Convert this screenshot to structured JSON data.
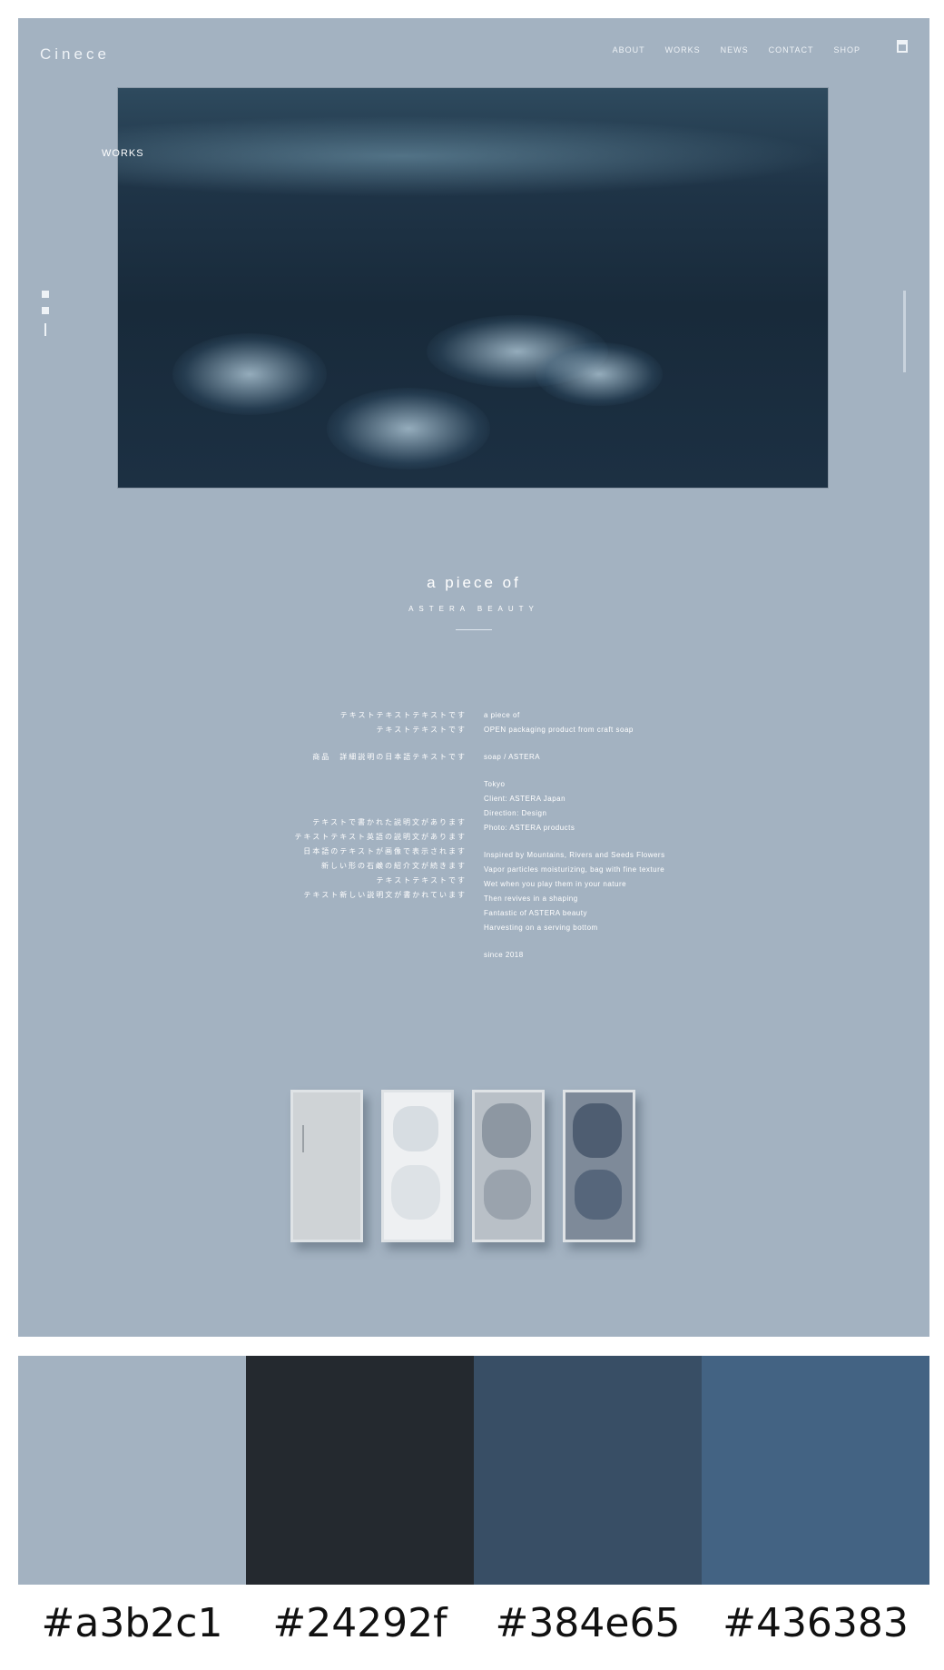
{
  "site": {
    "logo": "Cinece",
    "nav": [
      "ABOUT",
      "WORKS",
      "NEWS",
      "CONTACT",
      "SHOP"
    ],
    "hero_label": "WORKS"
  },
  "product": {
    "title": "a piece of",
    "subtitle": "ASTERA BEAUTY",
    "description_left": [
      "テキストテキストテキストです",
      "テキストテキストです",
      "",
      "商品　詳細説明の日本語テキストです",
      "",
      "テキストで書かれた説明文があります",
      "テキストテキスト英語の説明文があります",
      "日本語のテキストが画像で表示されます",
      "新しい形の石鹸の紹介文が続きます",
      "テキストテキストです",
      "テキスト新しい説明文が書かれています"
    ],
    "description_right": [
      "a piece of",
      "OPEN packaging product from craft soap",
      "",
      "soap / ASTERA",
      "",
      "Tokyo",
      "Client: ASTERA Japan",
      "Direction: Design",
      "Photo: ASTERA products",
      "",
      "Inspired by Mountains, Rivers and Seeds Flowers",
      "Vapor particles moisturizing, bag with fine texture",
      "Wet when you play them in your nature",
      "Then revives in a shaping",
      "Fantastic of ASTERA beauty",
      "Harvesting on a serving bottom",
      "",
      "since 2018"
    ]
  },
  "palette": {
    "colors": [
      "#a3b2c1",
      "#24292f",
      "#384e65",
      "#436383"
    ],
    "labels": [
      "#a3b2c1",
      "#24292f",
      "#384e65",
      "#436383"
    ]
  }
}
